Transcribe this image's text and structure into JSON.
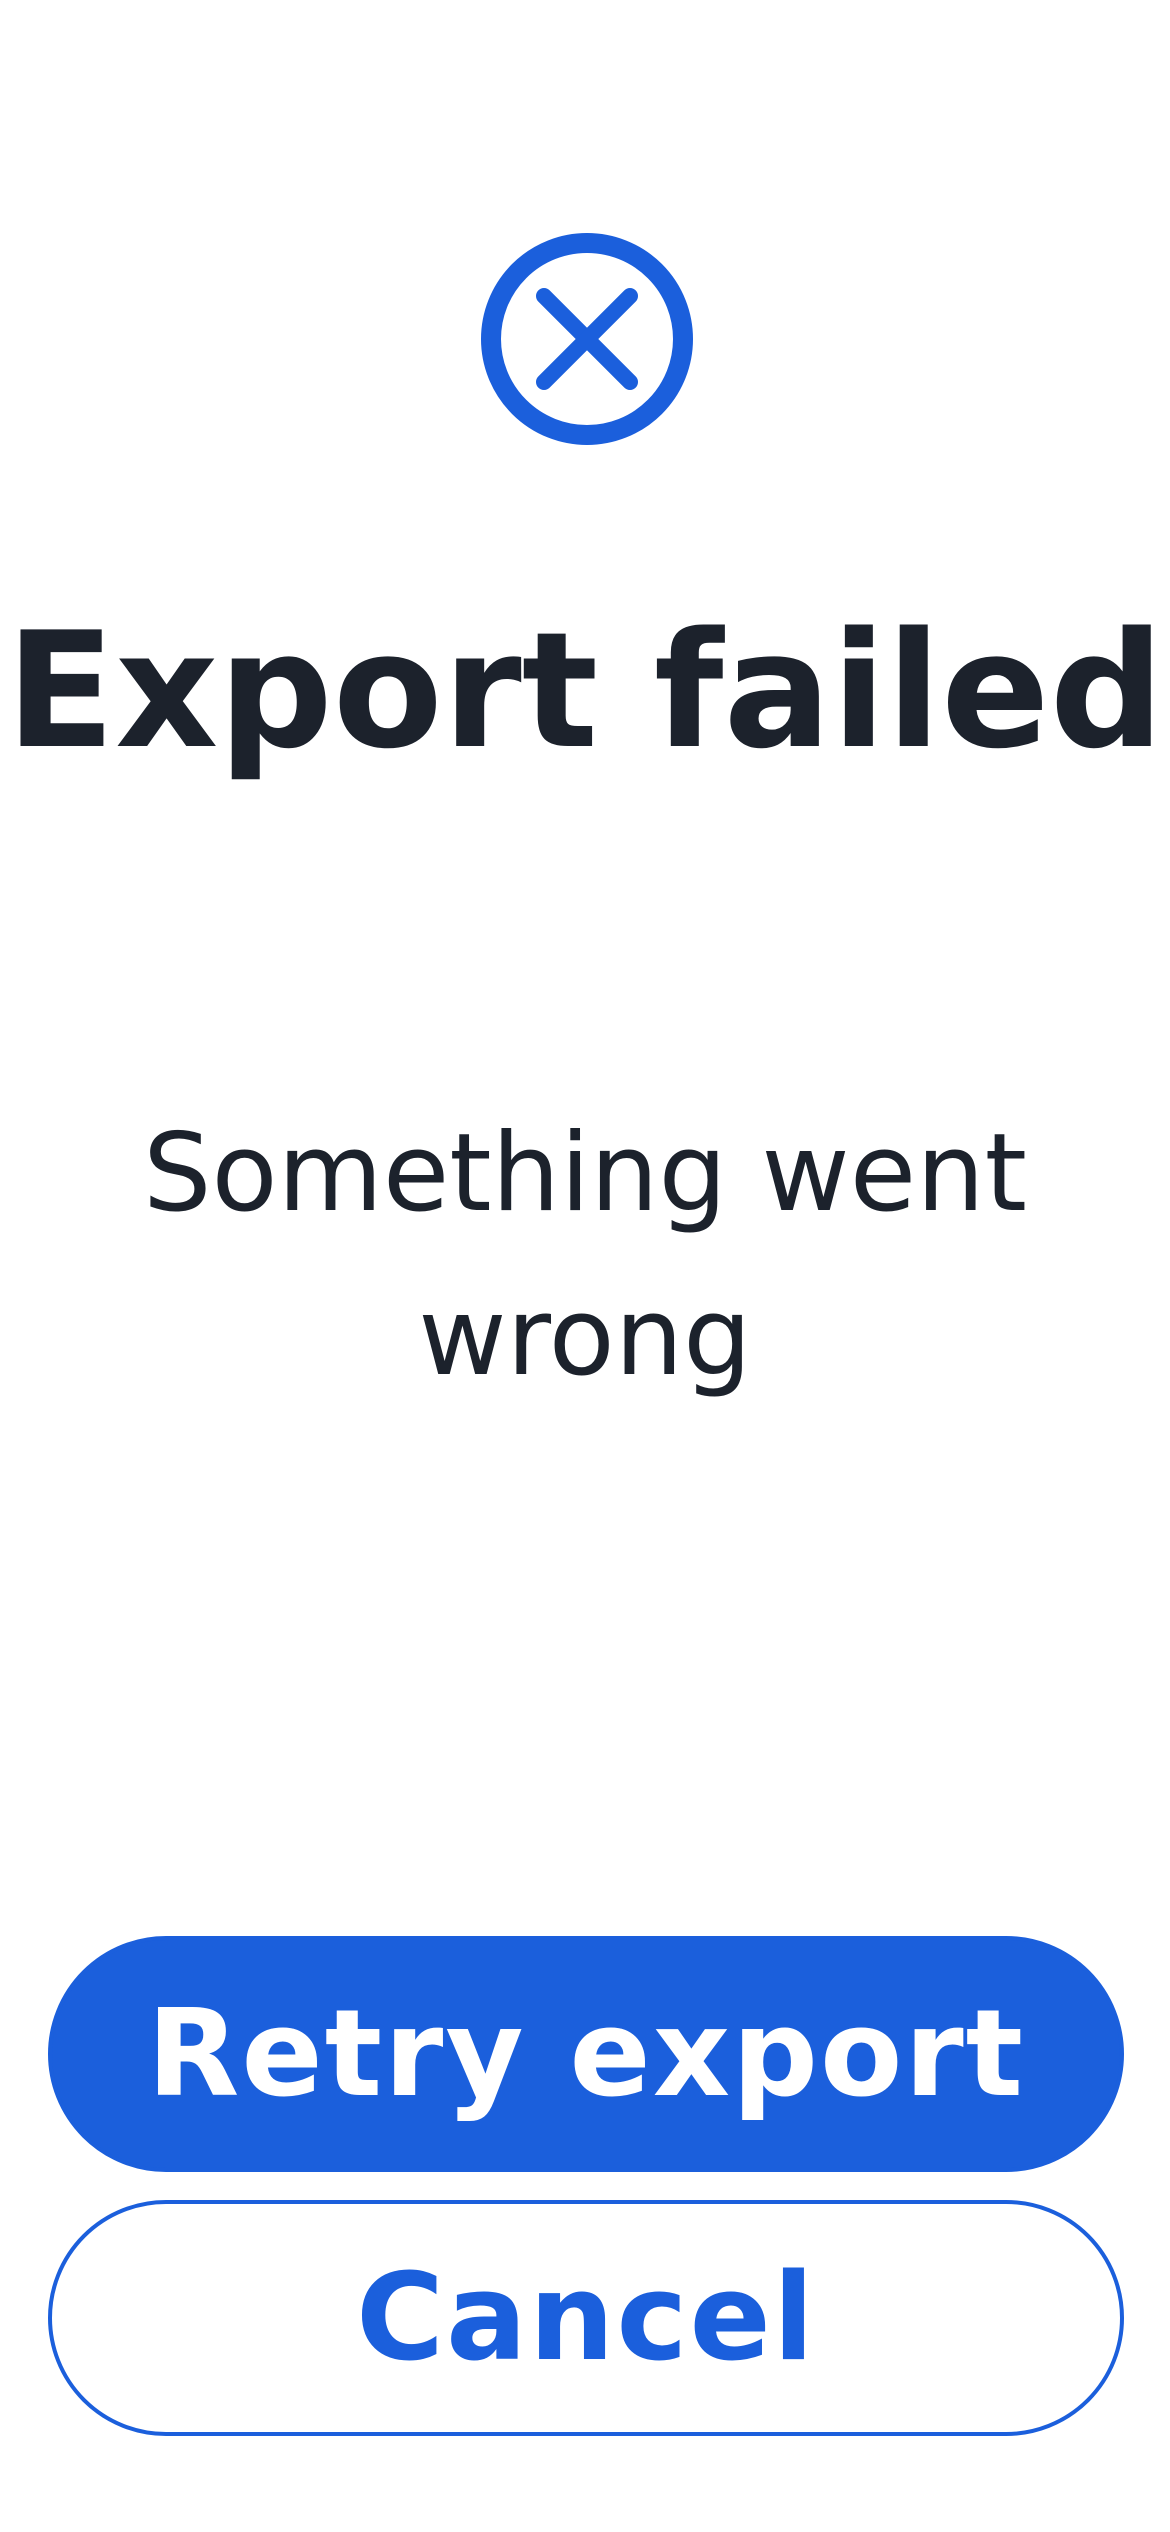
{
  "dialog": {
    "icon": "error-x-circle-icon",
    "title": "Export failed",
    "message": "Something went wrong"
  },
  "actions": {
    "primary_label": "Retry export",
    "secondary_label": "Cancel"
  },
  "colors": {
    "accent": "#1b5fdc",
    "text": "#1c222c",
    "background": "#ffffff"
  }
}
